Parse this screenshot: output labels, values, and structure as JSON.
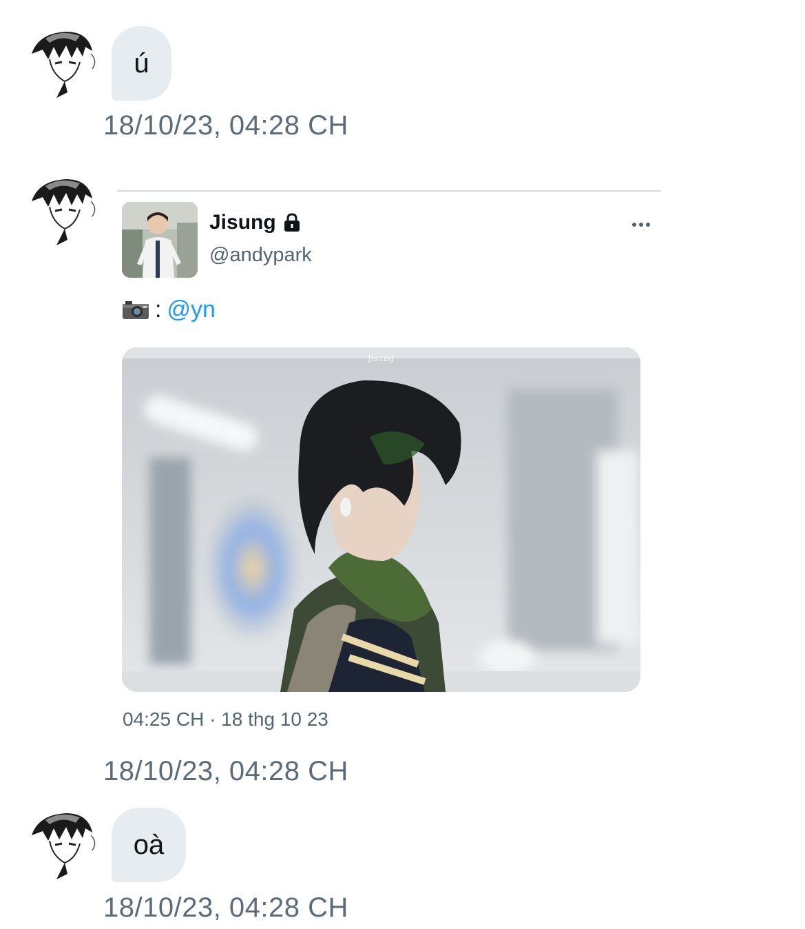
{
  "messages": [
    {
      "text": "ú",
      "timestamp": "18/10/23, 04:28 CH"
    },
    {
      "timestamp": "18/10/23, 04:28 CH"
    },
    {
      "text": "oà",
      "timestamp": "18/10/23, 04:28 CH"
    }
  ],
  "shared_tweet": {
    "display_name": "Jisung",
    "handle": "@andypark",
    "text_prefix_icon": "camera-icon",
    "text_separator": ":",
    "mention": "@yn",
    "meta": "04:25 CH · 18 thg 10 23",
    "photo_watermark": "Jisung"
  },
  "icons": {
    "lock": "lock-icon",
    "more": "more-icon",
    "camera": "camera-icon"
  },
  "colors": {
    "bubble_bg": "#e7ecf0",
    "timestamp": "#5b6b7a",
    "mention": "#1d9bf0",
    "muted": "#536471",
    "divider": "#cfd9de"
  }
}
